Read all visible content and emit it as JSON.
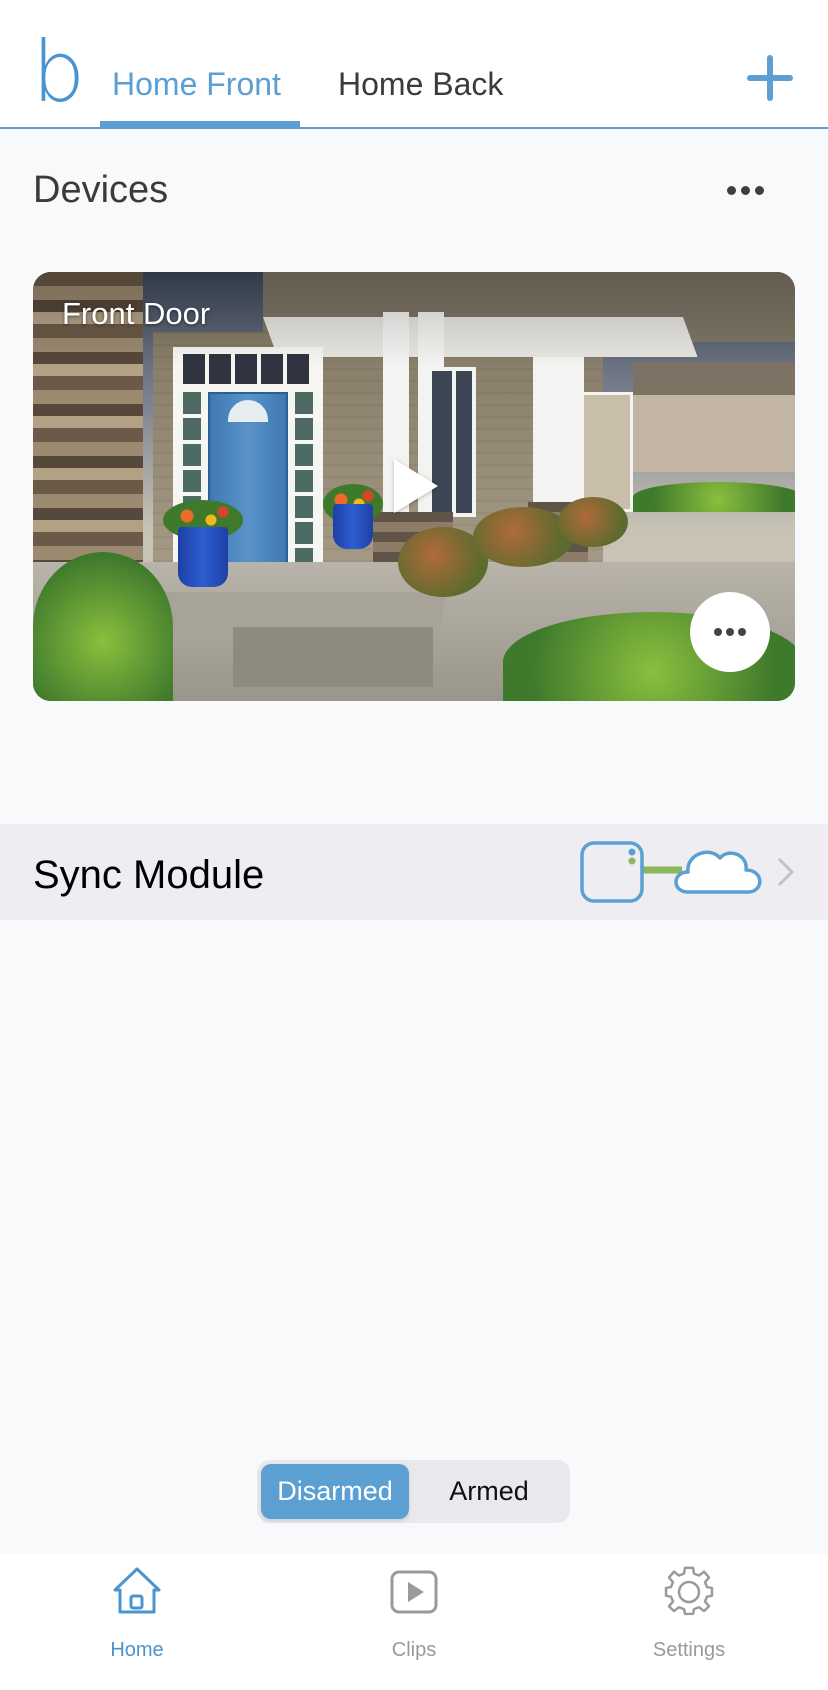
{
  "header": {
    "logo": "b",
    "tabs": [
      {
        "label": "Home Front",
        "active": true
      },
      {
        "label": "Home Back",
        "active": false
      }
    ],
    "add_icon": "plus-icon"
  },
  "devices": {
    "title": "Devices",
    "more_icon": "ellipsis-icon",
    "cameras": [
      {
        "name": "Front Door",
        "play_icon": "play-icon",
        "more_icon": "ellipsis-icon"
      }
    ]
  },
  "sync_module": {
    "label": "Sync Module",
    "status_icon": "sync-module-cloud-connected-icon",
    "chevron_icon": "chevron-right-icon"
  },
  "arm_control": {
    "options": [
      "Disarmed",
      "Armed"
    ],
    "selected": "Disarmed"
  },
  "tabbar": {
    "items": [
      {
        "label": "Home",
        "icon": "home-icon",
        "active": true
      },
      {
        "label": "Clips",
        "icon": "clips-play-icon",
        "active": false
      },
      {
        "label": "Settings",
        "icon": "gear-icon",
        "active": false
      }
    ]
  },
  "colors": {
    "accent": "#5b9fd3",
    "connection_ok": "#8ab85a",
    "inactive": "#9a9a9a"
  }
}
